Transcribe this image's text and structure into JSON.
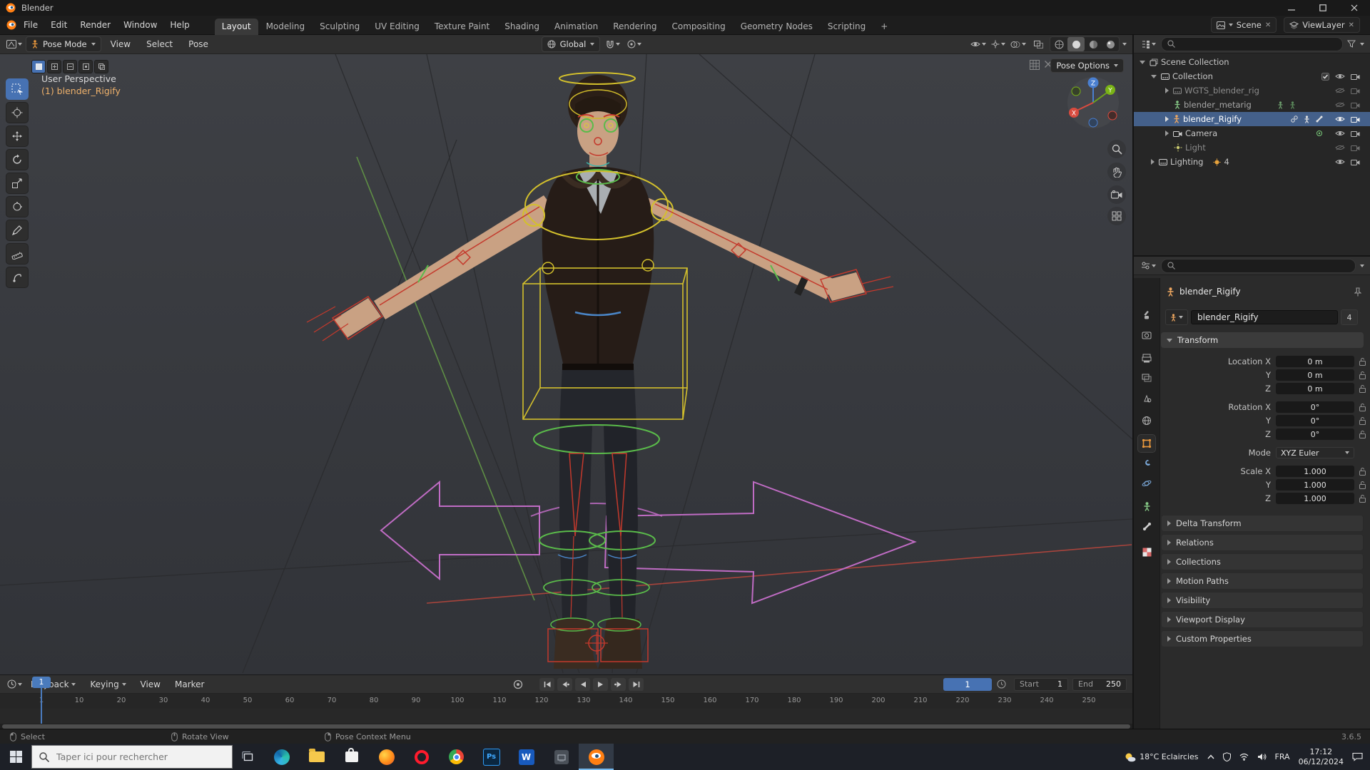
{
  "window": {
    "title": "Blender"
  },
  "topbar": {
    "menus": [
      "File",
      "Edit",
      "Render",
      "Window",
      "Help"
    ],
    "workspaces": [
      "Layout",
      "Modeling",
      "Sculpting",
      "UV Editing",
      "Texture Paint",
      "Shading",
      "Animation",
      "Rendering",
      "Compositing",
      "Geometry Nodes",
      "Scripting"
    ],
    "new_workspace_label": "+",
    "scene_name": "Scene",
    "view_layer_name": "ViewLayer"
  },
  "viewport": {
    "header": {
      "mode": "Pose Mode",
      "menus": [
        "View",
        "Select",
        "Pose"
      ],
      "orientation": "Global",
      "pose_options_label": "Pose Options"
    },
    "overlay": {
      "line1": "User Perspective",
      "line2": "(1) blender_Rigify"
    },
    "gizmo": {
      "x": "X",
      "y": "Y",
      "z": "Z"
    }
  },
  "outliner": {
    "rows": [
      {
        "label": "Scene Collection"
      },
      {
        "label": "Collection"
      },
      {
        "label": "WGTS_blender_rig"
      },
      {
        "label": "blender_metarig"
      },
      {
        "label": "blender_Rigify"
      },
      {
        "label": "Camera"
      },
      {
        "label": "Light"
      },
      {
        "label": "Lighting"
      }
    ],
    "lighting_count": "4"
  },
  "properties": {
    "active_object": "blender_Rigify",
    "id_name": "blender_Rigify",
    "users_count": "4",
    "transform_title": "Transform",
    "rows": [
      {
        "label": "Location X",
        "value": "0 m"
      },
      {
        "label": "Y",
        "value": "0 m"
      },
      {
        "label": "Z",
        "value": "0 m"
      },
      {
        "label": "Rotation X",
        "value": "0°"
      },
      {
        "label": "Y",
        "value": "0°"
      },
      {
        "label": "Z",
        "value": "0°"
      },
      {
        "label": "Mode",
        "value": "XYZ Euler"
      },
      {
        "label": "Scale X",
        "value": "1.000"
      },
      {
        "label": "Y",
        "value": "1.000"
      },
      {
        "label": "Z",
        "value": "1.000"
      }
    ],
    "panels": [
      "Delta Transform",
      "Relations",
      "Collections",
      "Motion Paths",
      "Visibility",
      "Viewport Display",
      "Custom Properties"
    ]
  },
  "timeline": {
    "menus": [
      "Playback",
      "Keying",
      "View",
      "Marker"
    ],
    "current_frame": "1",
    "start_label": "Start",
    "start_value": "1",
    "end_label": "End",
    "end_value": "250",
    "ticks": [
      "1",
      "10",
      "20",
      "30",
      "40",
      "50",
      "60",
      "70",
      "80",
      "90",
      "100",
      "110",
      "120",
      "130",
      "140",
      "150",
      "160",
      "170",
      "180",
      "190",
      "200",
      "210",
      "220",
      "230",
      "240",
      "250"
    ]
  },
  "statusbar": {
    "hints": [
      "Select",
      "Rotate View",
      "Pose Context Menu"
    ],
    "version": "3.6.5"
  },
  "taskbar": {
    "search_placeholder": "Taper ici pour rechercher",
    "weather": "18°C Eclaircies",
    "language": "FRA",
    "time": "17:12",
    "date": "06/12/2024",
    "photoshop_glyph": "Ps",
    "word_glyph": "W"
  },
  "colors": {
    "accent_blue": "#4772b3",
    "active_object_orange": "#eeb16b",
    "rig_yellow": "#d3c02c",
    "rig_green": "#5abb4a",
    "rig_red": "#c4392c",
    "rig_pink": "#c06cc4"
  }
}
